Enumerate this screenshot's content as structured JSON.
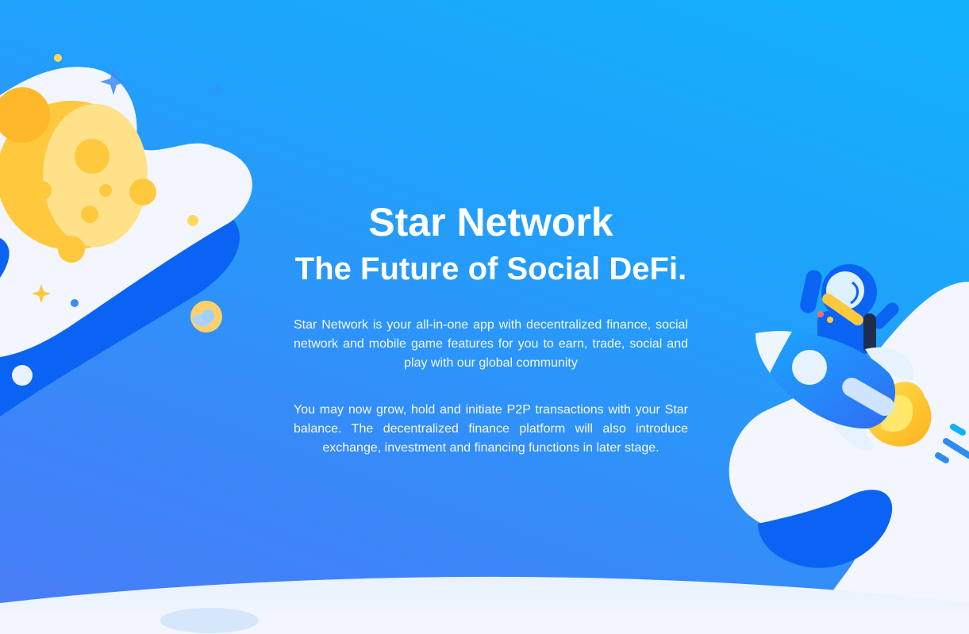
{
  "hero": {
    "title": "Star Network",
    "subtitle": "The Future of Social DeFi.",
    "paragraph_1": "Star Network is your all-in-one app with decentralized finance, social network and mobile game features for you to earn, trade, social and play with our global community",
    "paragraph_2": "You may now grow, hold and initiate P2P transactions with your Star balance. The decentralized finance platform will also introduce exchange, investment and financing functions in later stage."
  },
  "colors": {
    "background_top": "#12b2fb",
    "background_bottom": "#4a7cf6",
    "cloud": "#f3f6ff",
    "wave": "#0a63f3",
    "moon": "#ffc83d",
    "accent_yellow": "#ffd85a"
  },
  "icons": [
    "moon-icon",
    "rocket-icon",
    "astronaut-icon",
    "planet-icon",
    "sparkle-icon"
  ]
}
